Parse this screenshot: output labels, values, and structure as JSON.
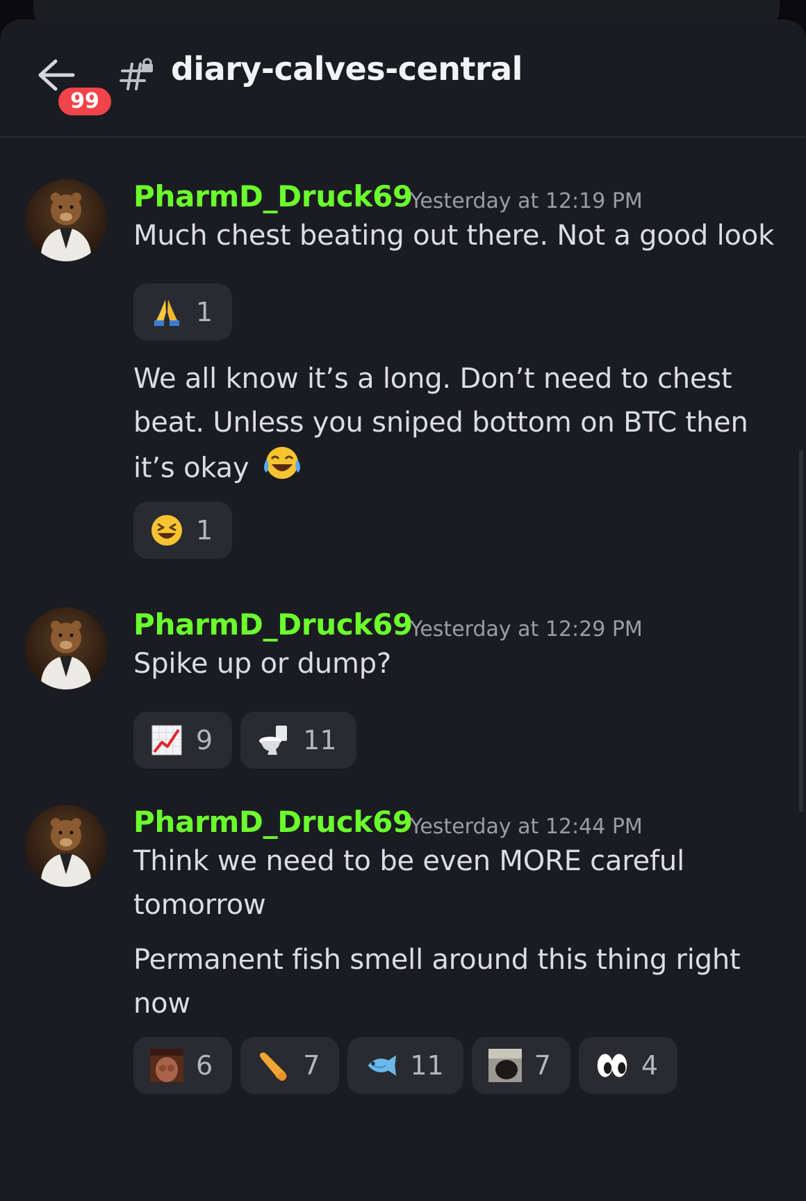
{
  "header": {
    "channel_name": "diary-calves-central",
    "unread_badge": "99"
  },
  "messages": [
    {
      "author": "PharmD_Druck69",
      "timestamp": "Yesterday at 12:19 PM",
      "lines": [
        {
          "text": "Much chest beating out there. Not a good look",
          "reactions": [
            {
              "emoji": "folded-hands",
              "count": "1"
            }
          ]
        },
        {
          "text": "We all know it’s a long. Don’t need to chest beat. Unless you sniped bottom on BTC then it’s okay",
          "trailing_emoji": "tears-of-joy",
          "reactions": [
            {
              "emoji": "laughing-squint",
              "count": "1"
            }
          ]
        }
      ]
    },
    {
      "author": "PharmD_Druck69",
      "timestamp": "Yesterday at 12:29 PM",
      "lines": [
        {
          "text": "Spike up or dump?",
          "reactions": [
            {
              "emoji": "chart-increasing",
              "count": "9"
            },
            {
              "emoji": "toilet",
              "count": "11"
            }
          ]
        }
      ]
    },
    {
      "author": "PharmD_Druck69",
      "timestamp": "Yesterday at 12:44 PM",
      "lines": [
        {
          "text": "Think we need to be even MORE careful tomorrow"
        },
        {
          "text": "Permanent fish smell around this thing right now",
          "reactions": [
            {
              "emoji": "custom-image-1",
              "count": "6"
            },
            {
              "emoji": "custom-banana",
              "count": "7"
            },
            {
              "emoji": "fish",
              "count": "11"
            },
            {
              "emoji": "custom-image-2",
              "count": "7"
            },
            {
              "emoji": "eyes",
              "count": "4"
            }
          ]
        }
      ]
    }
  ],
  "colors": {
    "background": "#1b1c21",
    "author": "#6bff2d",
    "badge": "#f0444a",
    "reaction_bg": "#2a2b31"
  }
}
